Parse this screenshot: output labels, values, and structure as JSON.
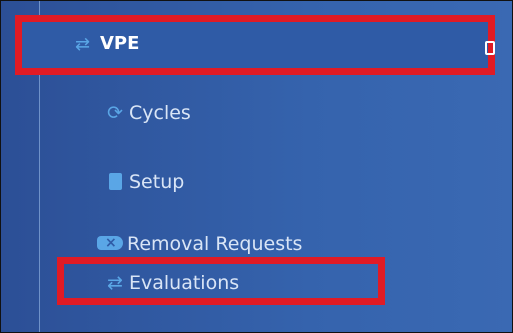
{
  "section": {
    "title": "VPE",
    "icon": "arrows-exchange-icon"
  },
  "items": [
    {
      "label": "Cycles",
      "icon": "refresh-icon"
    },
    {
      "label": "Setup",
      "icon": "book-icon"
    },
    {
      "label": "Removal Requests",
      "icon": "ticket-x-icon"
    },
    {
      "label": "Evaluations",
      "icon": "arrows-exchange-icon"
    }
  ],
  "colors": {
    "sidebar_bg": "#3563ad",
    "icon": "#5aa6e6",
    "highlight": "#e01b25",
    "text": "#d9e5f6"
  }
}
